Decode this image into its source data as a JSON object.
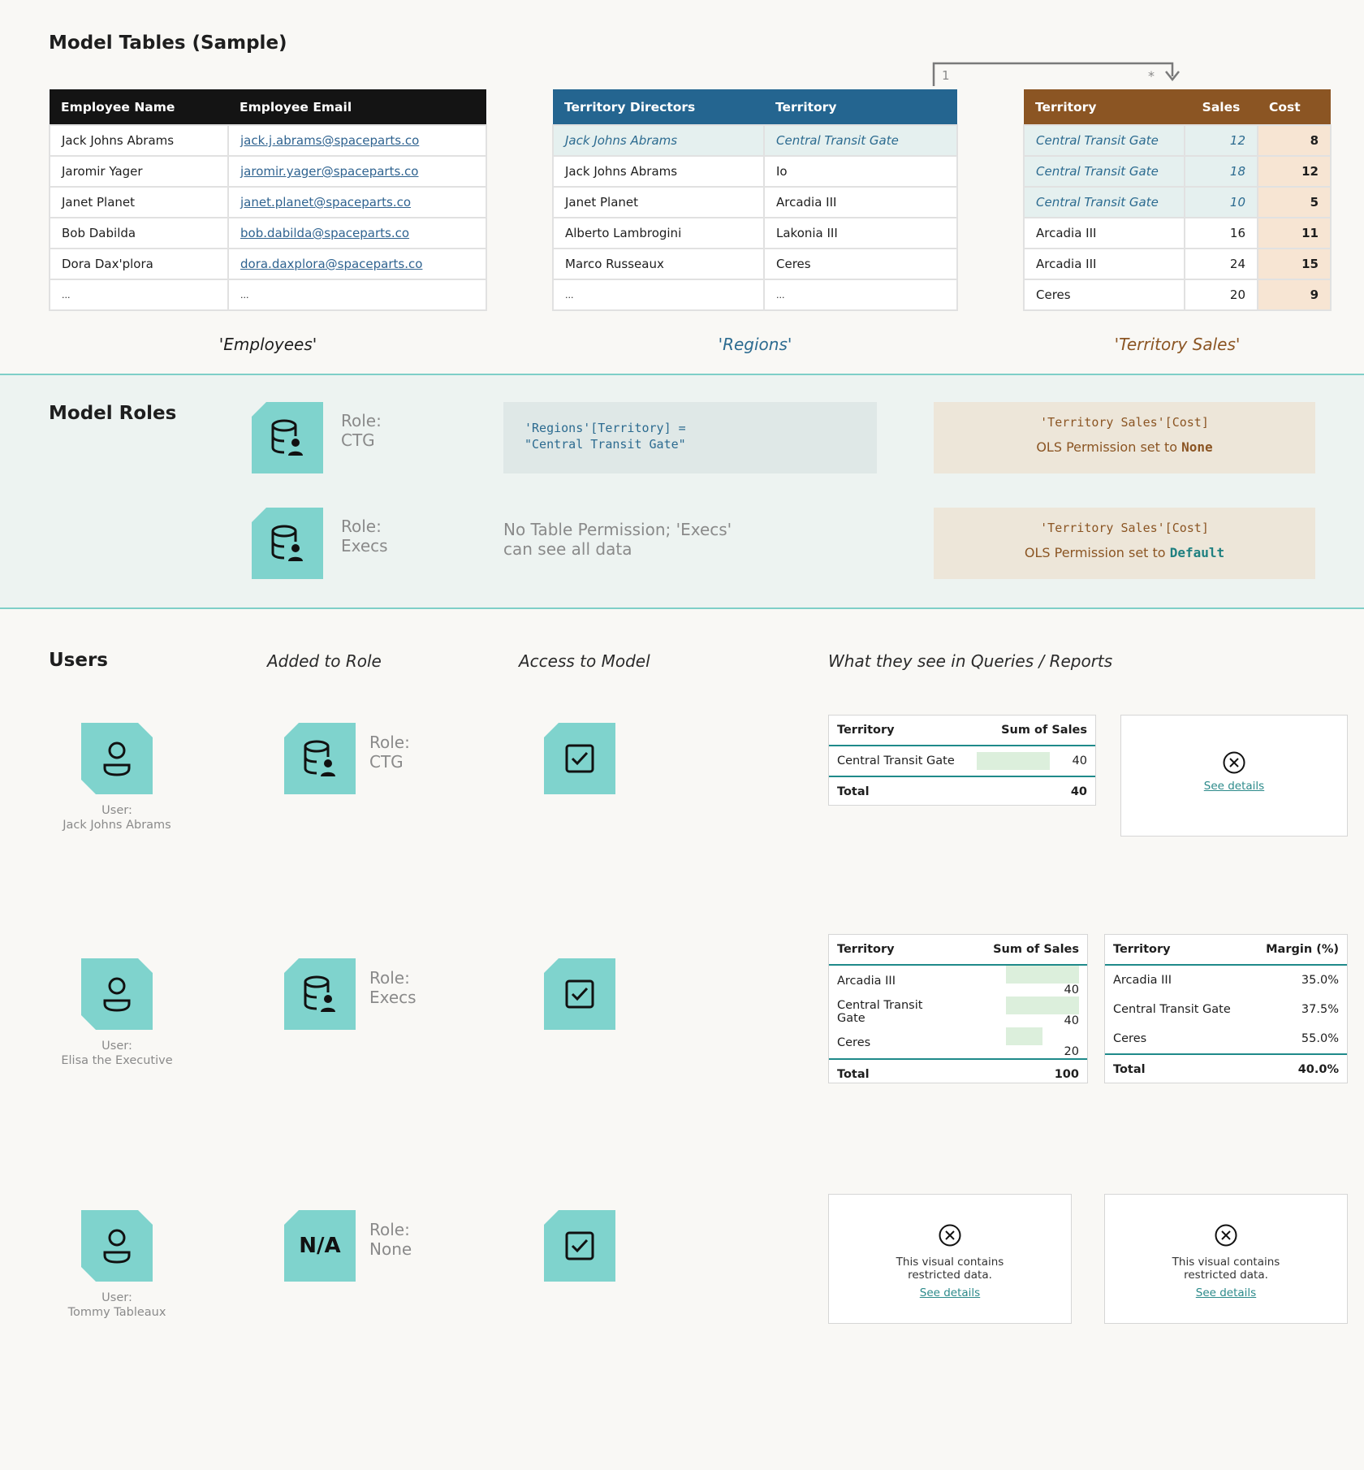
{
  "model_tables": {
    "title": "Model Tables (Sample)",
    "employees": {
      "caption": "'Employees'",
      "headers": [
        "Employee Name",
        "Employee Email"
      ],
      "rows": [
        [
          "Jack Johns Abrams",
          "jack.j.abrams@spaceparts.co"
        ],
        [
          "Jaromir Yager",
          "jaromir.yager@spaceparts.co"
        ],
        [
          "Janet Planet",
          "janet.planet@spaceparts.co"
        ],
        [
          "Bob Dabilda",
          "bob.dabilda@spaceparts.co"
        ],
        [
          "Dora Dax'plora",
          "dora.daxplora@spaceparts.co"
        ],
        [
          "...",
          "..."
        ]
      ]
    },
    "regions": {
      "caption": "'Regions'",
      "headers": [
        "Territory Directors",
        "Territory"
      ],
      "rows": [
        [
          "Jack Johns Abrams",
          "Central Transit Gate"
        ],
        [
          "Jack Johns Abrams",
          "Io"
        ],
        [
          "Janet Planet",
          "Arcadia III"
        ],
        [
          "Alberto Lambrogini",
          "Lakonia III"
        ],
        [
          "Marco Russeaux",
          "Ceres"
        ],
        [
          "...",
          "..."
        ]
      ]
    },
    "relationship": {
      "from_cardinality": "1",
      "to_cardinality": "*"
    },
    "territory_sales": {
      "caption": "'Territory Sales'",
      "headers": [
        "Territory",
        "Sales",
        "Cost"
      ],
      "rows": [
        [
          "Central Transit Gate",
          "12",
          "8"
        ],
        [
          "Central Transit Gate",
          "18",
          "12"
        ],
        [
          "Central Transit Gate",
          "10",
          "5"
        ],
        [
          "Arcadia III",
          "16",
          "11"
        ],
        [
          "Arcadia III",
          "24",
          "15"
        ],
        [
          "Ceres",
          "20",
          "9"
        ]
      ]
    }
  },
  "model_roles": {
    "title": "Model Roles",
    "roles": [
      {
        "label_line1": "Role:",
        "label_line2": "CTG",
        "rule_line1": "'Regions'[Territory] =",
        "rule_line2": "\"Central Transit Gate\"",
        "ols_column": "'Territory Sales'[Cost]",
        "ols_text": "OLS Permission set to",
        "ols_value": "None"
      },
      {
        "label_line1": "Role:",
        "label_line2": "Execs",
        "rule_line1": "No Table Permission; 'Execs'",
        "rule_line2": "can see all data",
        "ols_column": "'Territory Sales'[Cost]",
        "ols_text": "OLS Permission set to",
        "ols_value": "Default"
      }
    ]
  },
  "users": {
    "title": "Users",
    "col_added_to_role": "Added to Role",
    "col_access": "Access to Model",
    "col_what_they_see": "What they see in Queries / Reports",
    "rows": [
      {
        "user_prefix": "User:",
        "user_name": "Jack Johns Abrams",
        "role_prefix": "Role:",
        "role_name": "CTG",
        "role_icon_text": ""
      },
      {
        "user_prefix": "User:",
        "user_name": "Elisa the Executive",
        "role_prefix": "Role:",
        "role_name": "Execs",
        "role_icon_text": ""
      },
      {
        "user_prefix": "User:",
        "user_name": "Tommy Tableaux",
        "role_prefix": "Role:",
        "role_name": "None",
        "role_icon_text": "N/A"
      }
    ]
  },
  "visuals": {
    "ctg_sales": {
      "headers": [
        "Territory",
        "Sum of Sales"
      ],
      "rows": [
        {
          "territory": "Central Transit Gate",
          "value": "40",
          "bar_fraction": 1.0
        }
      ],
      "total_label": "Total",
      "total_value": "40"
    },
    "ctg_restricted": {
      "link": "See details"
    },
    "exec_sales": {
      "headers": [
        "Territory",
        "Sum of Sales"
      ],
      "rows": [
        {
          "territory": "Arcadia III",
          "value": "40",
          "bar_fraction": 1.0
        },
        {
          "territory": "Central Transit Gate",
          "value": "40",
          "bar_fraction": 1.0
        },
        {
          "territory": "Ceres",
          "value": "20",
          "bar_fraction": 0.5
        }
      ],
      "total_label": "Total",
      "total_value": "100"
    },
    "exec_margin": {
      "headers": [
        "Territory",
        "Margin (%)"
      ],
      "rows": [
        {
          "territory": "Arcadia III",
          "value": "35.0%"
        },
        {
          "territory": "Central Transit Gate",
          "value": "37.5%"
        },
        {
          "territory": "Ceres",
          "value": "55.0%"
        }
      ],
      "total_label": "Total",
      "total_value": "40.0%"
    },
    "tommy_left": {
      "message_line1": "This visual contains",
      "message_line2": "restricted data.",
      "link": "See details"
    },
    "tommy_right": {
      "message_line1": "This visual contains",
      "message_line2": "restricted data.",
      "link": "See details"
    }
  },
  "colors": {
    "teal": "#7fd3cd",
    "employees_header": "#141414",
    "regions_header": "#246590",
    "sales_header": "#8b5523",
    "cost_fill": "#f7e5d3",
    "band": "#edf3f1"
  }
}
